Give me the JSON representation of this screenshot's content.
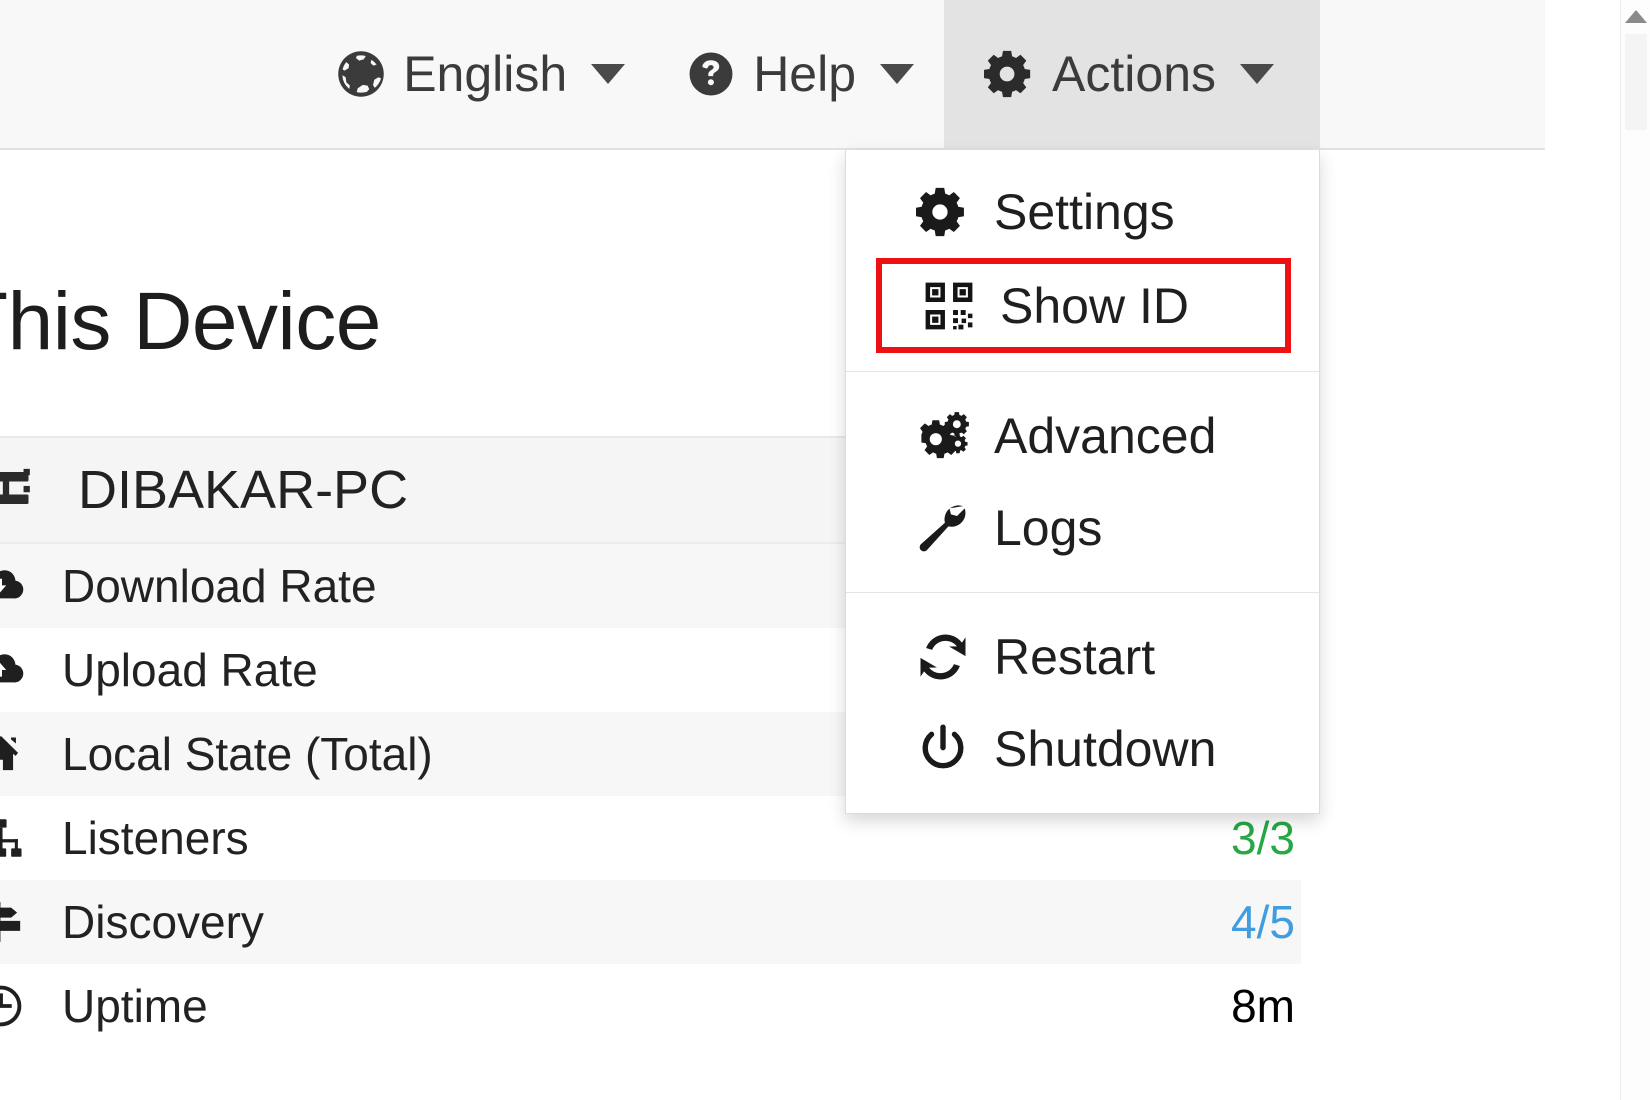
{
  "navbar": {
    "items": [
      {
        "label": "English",
        "icon": "globe-icon",
        "active": false
      },
      {
        "label": "Help",
        "icon": "question-circle-icon",
        "active": false
      },
      {
        "label": "Actions",
        "icon": "gear-icon",
        "active": true
      }
    ]
  },
  "main": {
    "page_title": "This Device",
    "device": {
      "name": "DIBAKAR-PC",
      "icon": "server-icon"
    },
    "stats": [
      {
        "label": "Download Rate",
        "icon": "cloud-download-icon",
        "value": "",
        "value_color": "#222222"
      },
      {
        "label": "Upload Rate",
        "icon": "cloud-upload-icon",
        "value": "",
        "value_color": "#222222"
      },
      {
        "label": "Local State (Total)",
        "icon": "home-icon",
        "value": "",
        "value_color": "#222222"
      },
      {
        "label": "Listeners",
        "icon": "sitemap-icon",
        "value": "3/3",
        "value_color": "#28a745"
      },
      {
        "label": "Discovery",
        "icon": "signpost-icon",
        "value": "4/5",
        "value_color": "#3f9de0"
      },
      {
        "label": "Uptime",
        "icon": "clock-icon",
        "value": "8m",
        "value_color": "#222222"
      }
    ]
  },
  "actions_menu": {
    "groups": [
      {
        "items": [
          {
            "label": "Settings",
            "icon": "gear-icon",
            "highlighted": false
          },
          {
            "label": "Show ID",
            "icon": "qr-code-icon",
            "highlighted": true
          }
        ]
      },
      {
        "items": [
          {
            "label": "Advanced",
            "icon": "cogs-icon",
            "highlighted": false
          },
          {
            "label": "Logs",
            "icon": "wrench-icon",
            "highlighted": false
          }
        ]
      },
      {
        "items": [
          {
            "label": "Restart",
            "icon": "sync-icon",
            "highlighted": false
          },
          {
            "label": "Shutdown",
            "icon": "power-icon",
            "highlighted": false
          }
        ]
      }
    ]
  },
  "colors": {
    "highlight_box": "#ee1111",
    "success": "#28a745",
    "info": "#3f9de0",
    "navbar_bg": "#f8f8f8",
    "active_nav_bg": "#e3e3e3"
  },
  "scrollbar": {
    "up_arrow_icon": "triangle-up-icon"
  }
}
